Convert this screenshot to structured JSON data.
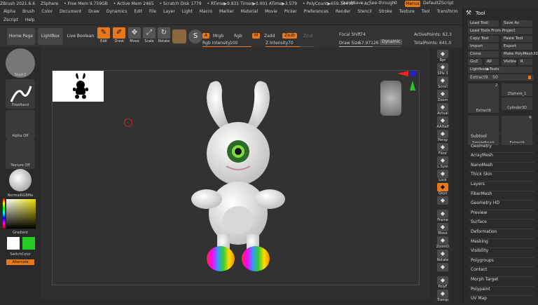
{
  "titlebar": {
    "items": [
      "ZBrush 2021.6.6",
      "ZSphere",
      "• Free Mem 9.759GB",
      "• Active Mem 2465",
      "• Scratch Disk 1779",
      "• RTime▶9.831 Timer▶0.001 ATime▶3.579",
      "• PolyCount▶659.344 KP",
      "• AC"
    ],
    "quicksave": "QuickSave",
    "seethrough": "See-through",
    "seethrough_value": "0",
    "menus": "Menus",
    "script": "DefaultZScript"
  },
  "menubar": {
    "row1": [
      "Alpha",
      "Brush",
      "Color",
      "Document",
      "Draw",
      "Dynamics",
      "Edit",
      "File",
      "Layer",
      "Light",
      "Macro",
      "Marker",
      "Material",
      "Movie",
      "Picker",
      "Preferences",
      "Render",
      "Stencil",
      "Stroke",
      "Texture",
      "Tool",
      "Transform",
      "Zplugin"
    ],
    "row2": [
      "Zscript",
      "Help"
    ]
  },
  "toolbar": {
    "home_page": "Home Page",
    "lightbox": "LightBox",
    "live_boolean": "Live Boolean",
    "edit": "Edit",
    "draw": "Draw",
    "move": "Move",
    "scale": "Scale",
    "rotate": "Rotate",
    "a_chip": "A",
    "mrgb": "Mrgb",
    "rgb": "Rgb",
    "m_chip": "M",
    "zadd": "Zadd",
    "zsub": "Zsub",
    "zcut": "Zcut",
    "rgb_intensity_label": "Rgb Intensity",
    "rgb_intensity_value": "100",
    "z_intensity_label": "Z Intensity",
    "z_intensity_value": "70",
    "focal_shift_label": "Focal Shift",
    "focal_shift_value": "74",
    "draw_size_label": "Draw Size",
    "draw_size_value": "57.97126",
    "dynamic": "Dynamic",
    "active_points": "ActivePoints: 62,3",
    "total_points": "TotalPoints: 641,0"
  },
  "leftpanel": {
    "slash3": "Slash3",
    "freehand": "FreeHand",
    "alpha_off": "Alpha Off",
    "texture_off": "Texture Off",
    "material": "NormalRGBMa",
    "gradient": "Gradient",
    "switchcolor": "SwitchColor",
    "alternate": "Alternate"
  },
  "rightstrip": [
    "Bpr",
    "SPix 3",
    "Scroll",
    "Zoom",
    "Actual",
    "AAHalf",
    "Persp",
    "Floor",
    "L.Sym",
    "Lock",
    "Qxyz",
    "",
    "Frame",
    "Move",
    "ZoomD",
    "Rotate",
    "",
    "PolyF",
    "Transp"
  ],
  "toolpanel": {
    "title": "Tool",
    "buttons": [
      [
        "Load Tool",
        "Save As"
      ],
      [
        "Load Tools From Project"
      ],
      [
        "Copy Tool",
        "Paste Tool"
      ],
      [
        "Import",
        "Export"
      ],
      [
        "Clone",
        "Make PolyMesh3D"
      ],
      [
        "GoZ",
        "All",
        "Visible",
        "R"
      ],
      [
        "Lightbox▶Tools"
      ]
    ],
    "current_tool": "Extract9.",
    "current_tool_value": "50",
    "thumbs": [
      "Extract9",
      "ZSphere_1",
      "Cylinder3D",
      "SimpleBrush",
      "Extract9"
    ],
    "thumb_count": "2",
    "thumb_count2": "4",
    "items": [
      "Subtool",
      "Geometry",
      "ArrayMesh",
      "NanoMesh",
      "Thick Skin",
      "Layers",
      "FiberMesh",
      "Geometry HD",
      "Preview",
      "Surface",
      "Deformation",
      "Masking",
      "Visibility",
      "Polygroups",
      "Contact",
      "Morph Target",
      "Polypaint",
      "UV Map"
    ]
  },
  "colors": {
    "accent": "#e9781c",
    "primary_color": "#ffffff",
    "secondary_color": "#22cc22"
  }
}
